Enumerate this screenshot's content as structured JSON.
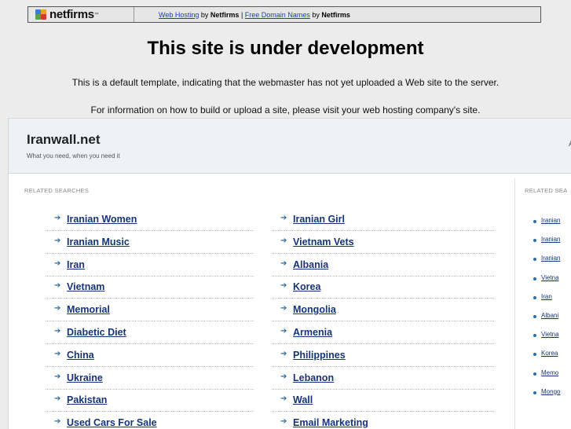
{
  "banner": {
    "logo": "netfirms",
    "link1": "Web Hosting",
    "by1": "by",
    "brand1": "Netfirms",
    "sep": "|",
    "link2": "Free Domain Names",
    "by2": "by",
    "brand2": "Netfirms"
  },
  "page": {
    "title": "This site is under development",
    "message1": "This is a default template, indicating that the webmaster has not yet uploaded a Web site to the server.",
    "message2": "For information on how to build or upload a site, please visit your web hosting company's site."
  },
  "parked": {
    "site_name": "Iranwall.net",
    "tagline": "What you need, when you need it",
    "edge_glyph": "A",
    "related_label": "RELATED SEARCHES",
    "side_label": "RELATED SEA",
    "left_links": [
      "Iranian Women",
      "Iranian Music",
      "Iran",
      "Vietnam",
      "Memorial",
      "Diabetic Diet",
      "China",
      "Ukraine",
      "Pakistan",
      "Used Cars For Sale"
    ],
    "right_links": [
      "Iranian Girl",
      "Vietnam Vets",
      "Albania",
      "Korea",
      "Mongolia",
      "Armenia",
      "Philippines",
      "Lebanon",
      "Wall",
      "Email Marketing"
    ],
    "side_links": [
      "Iranian",
      "Iranian",
      "Iranian",
      "Vietna",
      "Iran",
      "Albani",
      "Vietna",
      "Korea",
      "Memo",
      "Mongo"
    ]
  }
}
